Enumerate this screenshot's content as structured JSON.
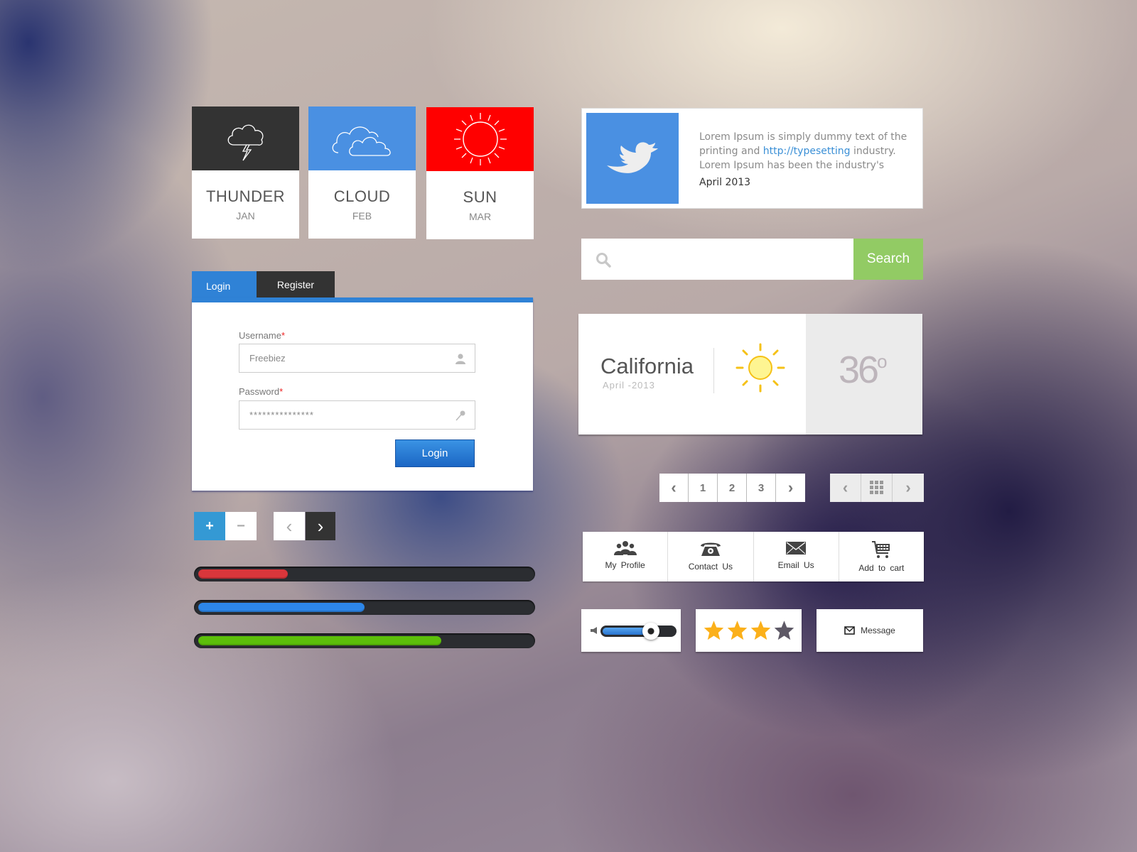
{
  "weather_tiles": [
    {
      "title": "THUNDER",
      "month": "JAN",
      "icon": "thunderstorm-icon",
      "color": "#333333"
    },
    {
      "title": "CLOUD",
      "month": "FEB",
      "icon": "cloud-icon",
      "color": "#4a90e2"
    },
    {
      "title": "SUN",
      "month": "MAR",
      "icon": "sun-icon",
      "color": "#ff0000"
    }
  ],
  "tweet": {
    "icon": "twitter-bird-icon",
    "text_before": "Lorem Ipsum is simply dummy text of the printing and ",
    "link": "http://typesetting",
    "text_after": " industry. Lorem Ipsum has been the industry's",
    "date": "April 2013"
  },
  "search": {
    "placeholder": "",
    "value": "",
    "button_label": "Search",
    "button_color": "#92cb64"
  },
  "login_form": {
    "tabs": [
      {
        "label": "Login",
        "active": true
      },
      {
        "label": "Register",
        "active": false
      }
    ],
    "username_label": "Username",
    "username_value": "Freebiez",
    "password_label": "Password",
    "password_value": "***************",
    "required_mark": "*",
    "submit_label": "Login",
    "accent_color": "#2f82d6"
  },
  "stepper": {
    "plus": "+",
    "minus": "−"
  },
  "pager_small": {
    "prev": "‹",
    "next": "›"
  },
  "progress_bars": [
    {
      "name": "red",
      "percent": 27,
      "color": "#d9363b"
    },
    {
      "name": "blue",
      "percent": 50,
      "color": "#2d86e8"
    },
    {
      "name": "green",
      "percent": 73,
      "color": "#5cbf0a"
    }
  ],
  "weather_card": {
    "city": "California",
    "date": "April  -2013",
    "temperature": "36",
    "unit": "o",
    "icon": "sun-icon"
  },
  "pagination": {
    "prev": "‹",
    "pages": [
      "1",
      "2",
      "3"
    ],
    "next": "›"
  },
  "pagination_grid": {
    "prev": "‹",
    "grid": "grid-icon",
    "next": "›"
  },
  "icon_bar": [
    {
      "label": "My Profile",
      "icon": "users-icon"
    },
    {
      "label": "Contact Us",
      "icon": "telephone-icon"
    },
    {
      "label": "Email Us",
      "icon": "envelope-icon"
    },
    {
      "label": "Add to cart",
      "icon": "cart-icon"
    }
  ],
  "volume": {
    "percent": 68
  },
  "rating": {
    "value": 3,
    "max": 4
  },
  "message_button": {
    "label": "Message"
  }
}
